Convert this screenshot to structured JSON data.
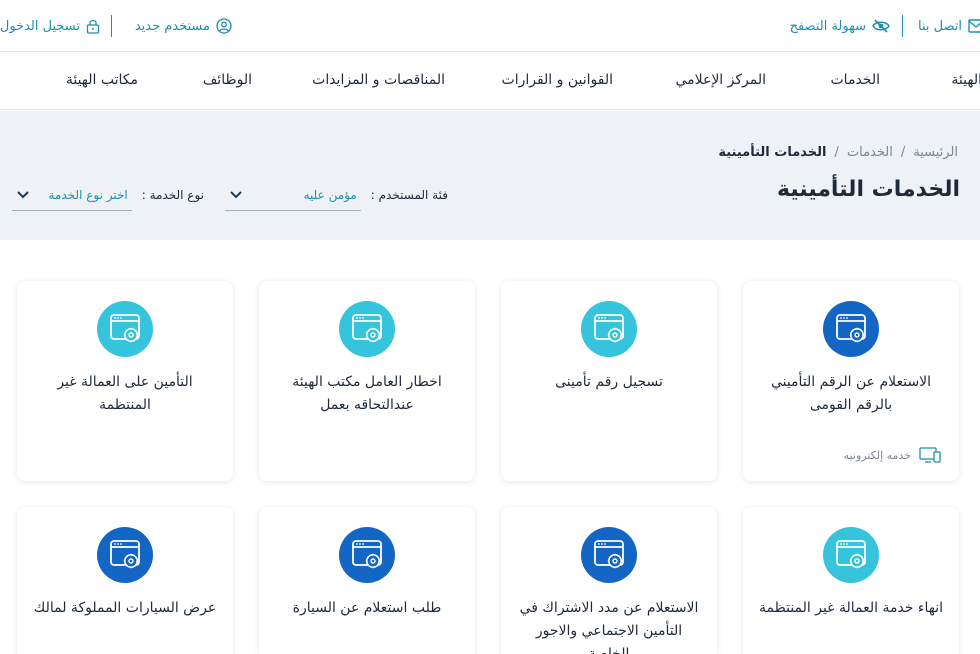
{
  "topbar": {
    "contact_label": "اتصل بنا",
    "accessibility_label": "سهولة التصفح",
    "new_user_label": "مستخدم جديد",
    "login_label": "تسجيل الدخول"
  },
  "nav": {
    "items": [
      "الهيئة",
      "الخدمات",
      "المركز الإعلامي",
      "القوانين و القرارات",
      "المناقصات و المزايدات",
      "الوظائف",
      "مكاتب الهيئة"
    ]
  },
  "breadcrumb": {
    "home": "الرئيسية",
    "sep": "/",
    "services": "الخدمات",
    "current": "الخدمات التأمينية"
  },
  "page_title": "الخدمات التأمينية",
  "filters": {
    "user_category_label": "فئة المستخدم :",
    "user_category_value": "مؤمن عليه",
    "service_type_label": "نوع الخدمة :",
    "service_type_value": "اختر نوع الخدمة"
  },
  "cards": [
    {
      "title": "الاستعلام عن الرقم التأميني بالرقم القومى",
      "icon": "browser-gear-icon",
      "badge": "خدمه إلكترونيه"
    },
    {
      "title": "تسجيل رقم تأمينى",
      "icon": "browser-gear-icon"
    },
    {
      "title": "اخطار العامل مكتب الهيئة عندالتحاقه بعمل",
      "icon": "browser-gear-icon"
    },
    {
      "title": "التأمين على العمالة غير المنتظمة",
      "icon": "browser-gear-icon"
    },
    {
      "title": "انهاء خدمة العمالة غير المنتظمة",
      "icon": "browser-gear-icon"
    },
    {
      "title": "الاستعلام عن مدد الاشتراك في التأمين الاجتماعي والاجور الخاصة",
      "icon": "browser-gear-icon"
    },
    {
      "title": "طلب استعلام عن السيارة",
      "icon": "browser-gear-icon"
    },
    {
      "title": "عرض السيارات المملوكة لمالك",
      "icon": "browser-gear-icon"
    }
  ],
  "colors": {
    "accent": "#1f8fa8",
    "icon_dark": "#1366c4",
    "icon_light": "#35c4dc",
    "band_bg": "#eef1f5"
  }
}
